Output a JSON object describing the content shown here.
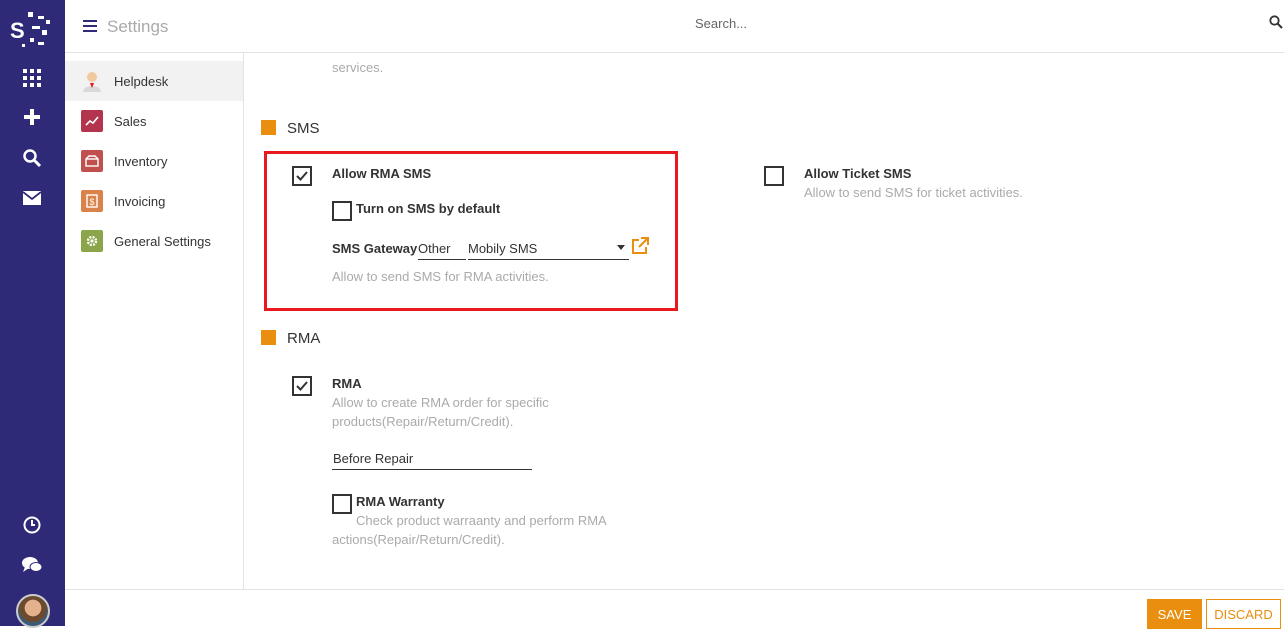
{
  "app": {
    "title": "Settings"
  },
  "search": {
    "placeholder": "Search..."
  },
  "rail": {
    "icons": [
      "apps-grid-icon",
      "plus-icon",
      "search-icon",
      "mail-icon",
      "clock-icon",
      "chat-icon"
    ]
  },
  "sidebar": {
    "items": [
      {
        "label": "Helpdesk",
        "icon": "helpdesk-user-icon",
        "active": true
      },
      {
        "label": "Sales",
        "icon": "sales-chart-icon"
      },
      {
        "label": "Inventory",
        "icon": "inventory-box-icon"
      },
      {
        "label": "Invoicing",
        "icon": "invoice-icon"
      },
      {
        "label": "General Settings",
        "icon": "gear-icon"
      }
    ]
  },
  "top_partial_text": "services.",
  "sms": {
    "title": "SMS",
    "allow_rma_sms": {
      "label": "Allow RMA SMS",
      "checked": true
    },
    "turn_on_default": {
      "label": "Turn on SMS by default",
      "checked": false
    },
    "gateway": {
      "label": "SMS Gateway",
      "type_value": "Other",
      "provider_value": "Mobily SMS"
    },
    "rma_help": "Allow to send SMS for RMA activities.",
    "allow_ticket_sms": {
      "label": "Allow Ticket SMS",
      "checked": false,
      "help": "Allow to send SMS for ticket activities."
    }
  },
  "rma": {
    "title": "RMA",
    "rma_option": {
      "label": "RMA",
      "checked": true,
      "help_line1": "Allow to create RMA order for specific",
      "help_line2": "products(Repair/Return/Credit)."
    },
    "stage_value": "Before Repair",
    "warranty": {
      "label": "RMA Warranty",
      "checked": false,
      "help_line1": "Check product warraanty and perform RMA",
      "help_line2": "actions(Repair/Return/Credit)."
    }
  },
  "footer": {
    "save_label": "SAVE",
    "discard_label": "DISCARD"
  },
  "colors": {
    "rail": "#2e2a78",
    "accent": "#ea8e0f",
    "highlight": "#e8191f"
  }
}
